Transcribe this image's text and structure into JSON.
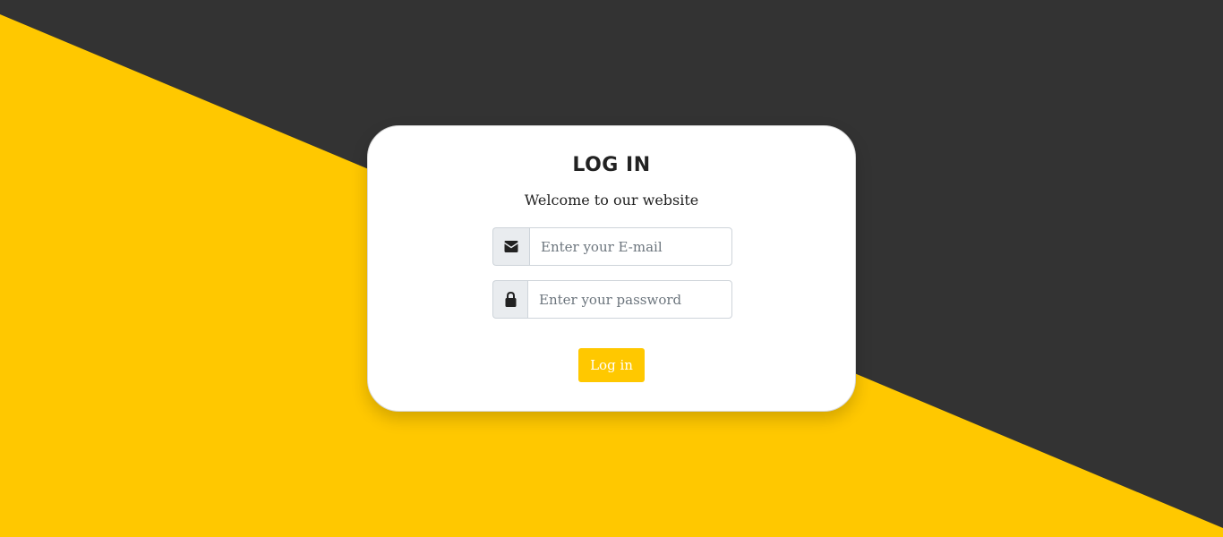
{
  "colors": {
    "background_dark": "#333333",
    "background_accent": "#ffc800",
    "card": "#ffffff",
    "button": "#ffc800",
    "button_text": "#ffffff",
    "addon_bg": "#e9ecef"
  },
  "login": {
    "title": "LOG IN",
    "subtitle": "Welcome to our website",
    "email": {
      "icon": "envelope-icon",
      "value": "",
      "placeholder": "Enter your E-mail"
    },
    "password": {
      "icon": "lock-icon",
      "value": "",
      "placeholder": "Enter your password"
    },
    "submit_label": "Log in"
  }
}
